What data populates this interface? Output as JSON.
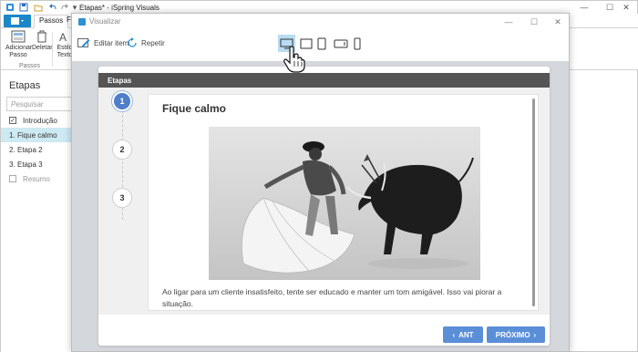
{
  "app": {
    "title": "Etapas* - iSpring Visuals",
    "ribbon_tabs": [
      "Passos",
      "F"
    ],
    "ribbon_buttons": {
      "add_step": "Adicionar Passo",
      "delete": "Deletar",
      "text_style": "Estilo Texto"
    },
    "ribbon_group": "Passos",
    "panel": {
      "title": "Etapas",
      "search_placeholder": "Pesquisar",
      "items": [
        {
          "num": "",
          "label": "Introdução",
          "checked": true
        },
        {
          "num": "1.",
          "label": "Fique calmo",
          "selected": true
        },
        {
          "num": "2.",
          "label": "Etapa 2"
        },
        {
          "num": "3.",
          "label": "Etapa 3"
        },
        {
          "num": "",
          "label": "Resumo",
          "checked": false
        }
      ]
    }
  },
  "preview": {
    "title": "Visualizar",
    "toolbar": {
      "edit_item": "Editar item",
      "repeat": "Repetir",
      "devices": [
        "desktop",
        "tablet-landscape",
        "tablet-portrait",
        "phone-landscape",
        "phone-portrait"
      ],
      "active_device": "desktop"
    },
    "player": {
      "header": "Etapas",
      "steps": [
        "1",
        "2",
        "3"
      ],
      "active_step": "1",
      "card": {
        "title": "Fique calmo",
        "text": "Ao ligar para um cliente insatisfeito, tente ser educado e manter um tom amigável. Isso vai piorar a situação."
      },
      "prev_label": "ANT",
      "next_label": "PRÓXIMO"
    }
  },
  "colors": {
    "accent": "#1b87c8",
    "nav_button": "#5a8fd8",
    "header_bar": "#555555",
    "active_step": "#4f7fc9",
    "selected_row": "#cde9f2"
  }
}
